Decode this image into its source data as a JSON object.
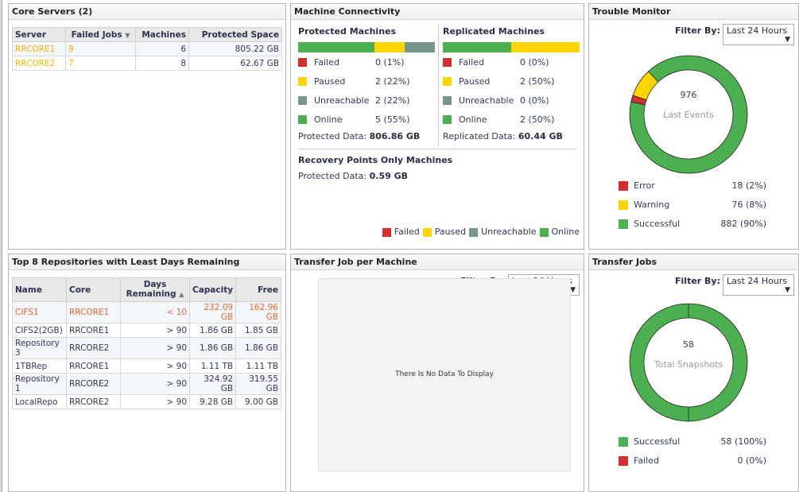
{
  "colors": {
    "failed": "#d32f2f",
    "paused": "#ffd400",
    "unreachable": "#76978a",
    "online": "#4caf50"
  },
  "core_servers": {
    "title": "Core Servers (2)",
    "columns": [
      "Server",
      "Failed Jobs",
      "Machines",
      "Protected Space"
    ],
    "rows": [
      [
        "RRCORE1",
        "9",
        "6",
        "805.22 GB"
      ],
      [
        "RRCORE2",
        "7",
        "8",
        "62.67 GB"
      ]
    ]
  },
  "repos": {
    "title": "Top 8 Repositories with Least Days Remaining",
    "columns": [
      "Name",
      "Core",
      "Days Remaining",
      "Capacity",
      "Free"
    ],
    "rows": [
      [
        "CIFS1",
        "RRCORE1",
        "< 10",
        "232.09 GB",
        "162.96 GB"
      ],
      [
        "CIFS2(2GB)",
        "RRCORE1",
        "> 90",
        "1.86 GB",
        "1.85 GB"
      ],
      [
        "Repository 3",
        "RRCORE2",
        "> 90",
        "1.86 GB",
        "1.86 GB"
      ],
      [
        "1TBRep",
        "RRCORE1",
        "> 90",
        "1.11 TB",
        "1.11 TB"
      ],
      [
        "Repository 1",
        "RRCORE2",
        "> 90",
        "324.92 GB",
        "319.55 GB"
      ],
      [
        "LocalRepo",
        "RRCORE2",
        "> 90",
        "9.28 GB",
        "9.00 GB"
      ]
    ]
  },
  "connectivity": {
    "title": "Machine Connectivity",
    "protected": {
      "title": "Protected Machines",
      "items": [
        {
          "label": "Failed",
          "value": "0 (1%)"
        },
        {
          "label": "Paused",
          "value": "2 (22%)"
        },
        {
          "label": "Unreachable",
          "value": "2 (22%)"
        },
        {
          "label": "Online",
          "value": "5 (55%)"
        }
      ],
      "bar": [
        0,
        22,
        22,
        55
      ],
      "data_label": "Protected Data:",
      "data_value": "806.86 GB"
    },
    "replicated": {
      "title": "Replicated Machines",
      "items": [
        {
          "label": "Failed",
          "value": "0 (0%)"
        },
        {
          "label": "Paused",
          "value": "2 (50%)"
        },
        {
          "label": "Unreachable",
          "value": "0 (0%)"
        },
        {
          "label": "Online",
          "value": "2 (50%)"
        }
      ],
      "bar": [
        0,
        50,
        0,
        50
      ],
      "data_label": "Replicated Data:",
      "data_value": "60.44 GB"
    },
    "rp_only": {
      "title": "Recovery Points Only Machines",
      "data_label": "Protected Data:",
      "data_value": "0.59 GB"
    },
    "legend": [
      "Failed",
      "Paused",
      "Unreachable",
      "Online"
    ]
  },
  "trouble": {
    "title": "Trouble Monitor",
    "filter_label": "Filter By:",
    "filter_value": "Last 24 Hours",
    "total": "976",
    "center_label": "Last Events",
    "items": [
      {
        "label": "Error",
        "value": "18 (2%)",
        "count": 18
      },
      {
        "label": "Warning",
        "value": "76 (8%)",
        "count": 76
      },
      {
        "label": "Successful",
        "value": "882 (90%)",
        "count": 882
      }
    ]
  },
  "transfer_machine": {
    "title": "Transfer Job per Machine",
    "filter_label": "Filter By:",
    "filter_value": "Last 24 Hours",
    "empty": "There Is No Data To Display"
  },
  "transfer_jobs": {
    "title": "Transfer Jobs",
    "filter_label": "Filter By:",
    "filter_value": "Last 24 Hours",
    "total": "58",
    "center_label": "Total Snapshots",
    "items": [
      {
        "label": "Successful",
        "value": "58 (100%)",
        "count": 58
      },
      {
        "label": "Failed",
        "value": "0 (0%)",
        "count": 0
      }
    ]
  }
}
